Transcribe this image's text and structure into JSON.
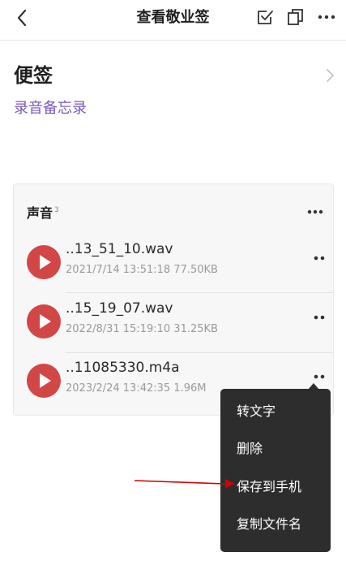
{
  "header": {
    "title": "查看敬业签",
    "icons": [
      "back-chevron-icon",
      "check-square-icon",
      "copy-icon",
      "more-icon"
    ]
  },
  "note": {
    "title": "便签",
    "body": "录音备忘录"
  },
  "audio_card": {
    "title": "声音",
    "count": "3",
    "items": [
      {
        "name": "..13_51_10.wav",
        "meta": "2021/7/14 13:51:18 77.50KB"
      },
      {
        "name": "..15_19_07.wav",
        "meta": "2022/8/31 15:19:10 31.25KB"
      },
      {
        "name": "..11085330.m4a",
        "meta": "2023/2/24 13:42:35 1.96M"
      }
    ]
  },
  "context_menu": {
    "items": [
      "转文字",
      "删除",
      "保存到手机",
      "复制文件名"
    ]
  },
  "colors": {
    "play_button": "#d24646",
    "accent_text": "#7b58b8",
    "menu_bg": "#2d2d2d",
    "annotation_arrow": "#d40000"
  }
}
